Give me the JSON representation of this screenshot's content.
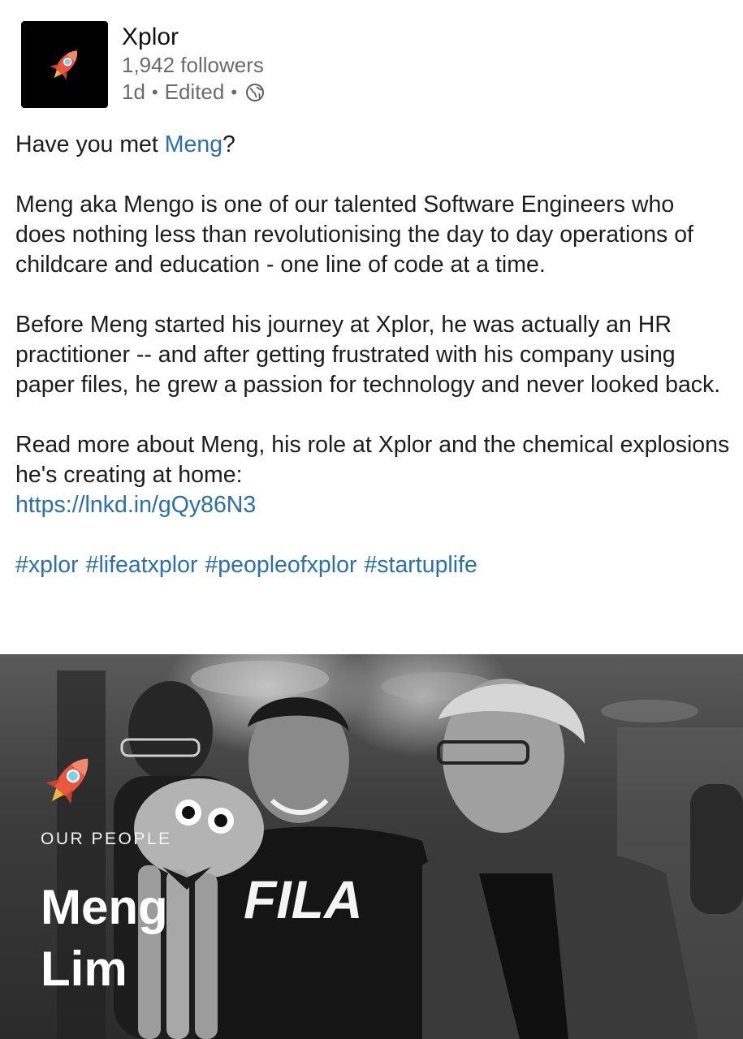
{
  "post": {
    "author": {
      "name": "Xplor",
      "followers": "1,942 followers",
      "age": "1d",
      "edited": "Edited",
      "visibility_icon": "globe-icon",
      "avatar_icon": "rocket-icon"
    },
    "intro": {
      "before": "Have you met ",
      "mention": "Meng",
      "after": "?"
    },
    "paragraph_1": "Meng aka Mengo is one of our talented Software Engineers who does nothing less than revolutionising the day to day operations of childcare and education - one line of code at a time.",
    "paragraph_2": "Before Meng started his journey at Xplor, he was actually an HR practitioner -- and after getting frustrated with his company using paper files, he grew a passion for technology and never looked back.",
    "paragraph_3": "Read more about Meng, his role at Xplor and the chemical explosions he's creating at home:",
    "link": "https://lnkd.in/gQy86N3",
    "hashtags": [
      "#xplor",
      "#lifeatxplor",
      "#peopleofxplor",
      "#startuplife"
    ]
  },
  "image": {
    "label": "OUR PEOPLE",
    "name_line_1": "Meng",
    "name_line_2": "Lim",
    "shirt_text": "FILA",
    "icon": "rocket-icon"
  },
  "colors": {
    "link": "#2a6fb0",
    "text": "#1d1d1d",
    "muted": "#6b6b6b",
    "rocket": "#e8573e"
  }
}
